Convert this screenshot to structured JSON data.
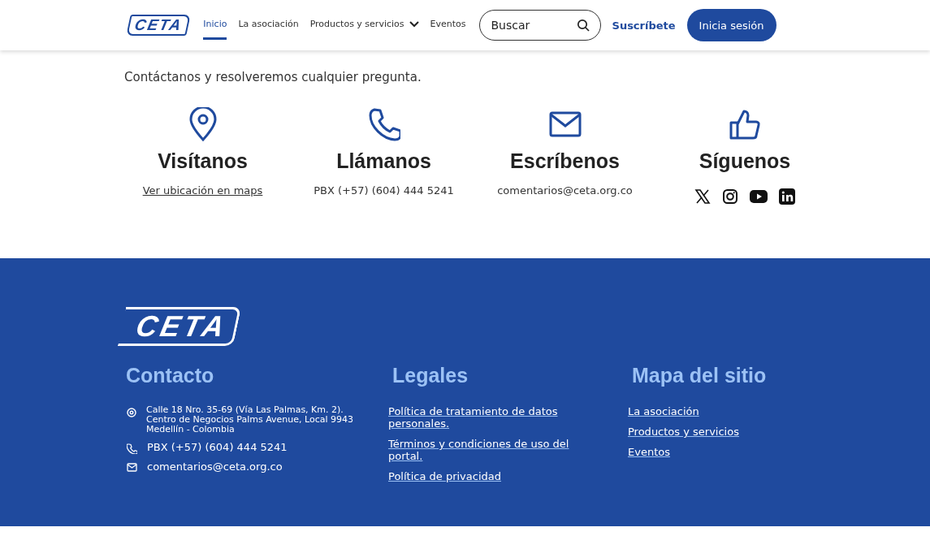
{
  "header": {
    "logo": "CETA",
    "nav": [
      {
        "label": "Inicio",
        "selected": true,
        "dropdown": false
      },
      {
        "label": "La asociación",
        "selected": false,
        "dropdown": false
      },
      {
        "label": "Productos y servicios",
        "selected": false,
        "dropdown": true
      },
      {
        "label": "Eventos",
        "selected": false,
        "dropdown": false
      }
    ],
    "search": {
      "placeholder": "Buscar"
    },
    "subscribe": "Suscríbete",
    "login": "Inicia sesión"
  },
  "intro": "Contáctanos y resolveremos cualquier pregunta.",
  "contact_cards": [
    {
      "kind": "visit",
      "title": "Visítanos",
      "text": "Ver ubicación en maps",
      "link": true
    },
    {
      "kind": "call",
      "title": "Llámanos",
      "text": "PBX (+57) (604) 444 5241",
      "link": false
    },
    {
      "kind": "write",
      "title": "Escríbenos",
      "text": "comentarios@ceta.org.co",
      "link": false
    },
    {
      "kind": "follow",
      "title": "Síguenos",
      "social": [
        {
          "kind": "x"
        },
        {
          "kind": "instagram"
        },
        {
          "kind": "youtube"
        },
        {
          "kind": "linkedin"
        }
      ]
    }
  ],
  "footer": {
    "logo": "CETA",
    "contact": {
      "title": "Contacto",
      "items": [
        {
          "kind": "address",
          "text": "Calle 18 Nro. 35-69 (Vía Las Palmas, Km. 2). Centro de Negocios Palms Avenue, Local 9943  Medellín - Colombia"
        },
        {
          "kind": "phone",
          "text": "PBX (+57) (604) 444 5241"
        },
        {
          "kind": "mail",
          "text": "comentarios@ceta.org.co"
        }
      ]
    },
    "legal": {
      "title": "Legales",
      "links": [
        "Política de tratamiento de datos personales.",
        "Términos y condiciones de uso del portal.",
        "Política de privacidad"
      ]
    },
    "sitemap": {
      "title": "Mapa del sitio",
      "links": [
        "La asociación",
        "Productos y servicios",
        "Eventos"
      ]
    }
  }
}
